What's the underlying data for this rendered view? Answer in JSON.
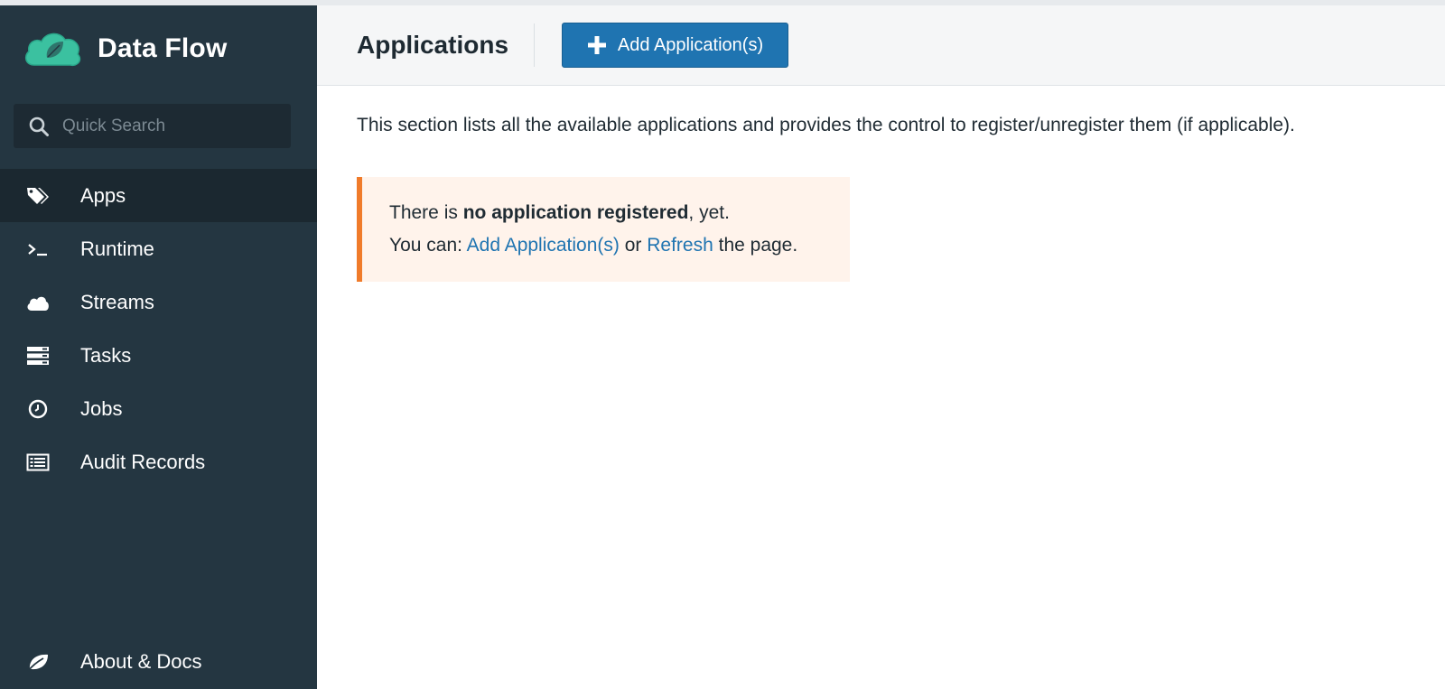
{
  "brand": {
    "title": "Data Flow",
    "logo_icon": "spring-cloud-leaf-icon",
    "accent": "#3bc1a0"
  },
  "search": {
    "placeholder": "Quick Search",
    "value": ""
  },
  "sidebar": {
    "items": [
      {
        "label": "Apps",
        "icon": "tags-icon",
        "active": true
      },
      {
        "label": "Runtime",
        "icon": "terminal-icon"
      },
      {
        "label": "Streams",
        "icon": "cloud-icon"
      },
      {
        "label": "Tasks",
        "icon": "server-icon"
      },
      {
        "label": "Jobs",
        "icon": "clock-icon"
      },
      {
        "label": "Audit Records",
        "icon": "list-icon"
      }
    ],
    "footer": {
      "label": "About & Docs",
      "icon": "leaf-icon"
    }
  },
  "header": {
    "title": "Applications",
    "add_button_label": "Add Application(s)"
  },
  "main": {
    "intro": "This section lists all the available applications and provides the control to register/unregister them (if applicable).",
    "notice": {
      "line1_prefix": "There is ",
      "line1_bold": "no application registered",
      "line1_suffix": ", yet.",
      "line2_prefix": "You can: ",
      "link_add": "Add Application(s)",
      "line2_or": " or ",
      "link_refresh": "Refresh",
      "line2_suffix": " the page."
    }
  },
  "colors": {
    "sidebar_bg": "#243641",
    "primary": "#1f74b1",
    "warning": "#f07b2a",
    "warning_bg": "#fff3eb"
  }
}
